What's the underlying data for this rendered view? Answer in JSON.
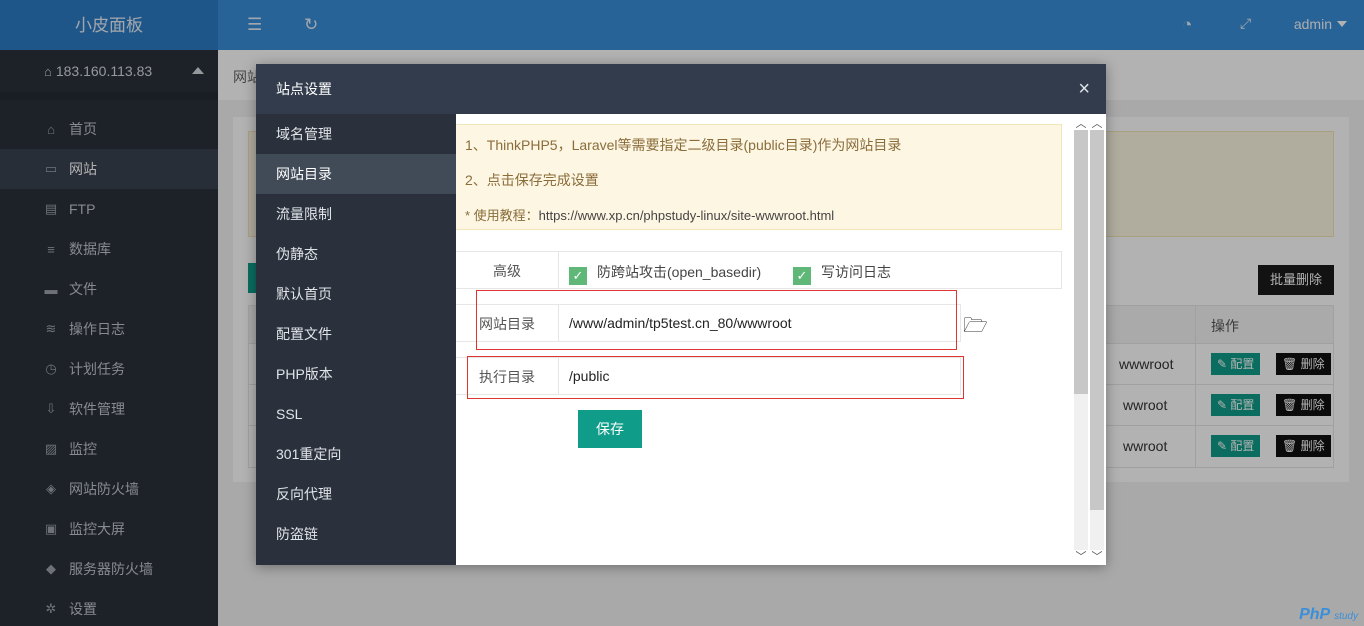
{
  "sidebar": {
    "brand": "小皮面板",
    "server": "183.160.113.83",
    "items": [
      {
        "label": "首页",
        "icon": "⌂"
      },
      {
        "label": "网站",
        "icon": "▭"
      },
      {
        "label": "FTP",
        "icon": "▤"
      },
      {
        "label": "数据库",
        "icon": "≡"
      },
      {
        "label": "文件",
        "icon": "▬"
      },
      {
        "label": "操作日志",
        "icon": "≋"
      },
      {
        "label": "计划任务",
        "icon": "◷"
      },
      {
        "label": "软件管理",
        "icon": "⇩"
      },
      {
        "label": "监控",
        "icon": "▨"
      },
      {
        "label": "网站防火墙",
        "icon": "◈"
      },
      {
        "label": "监控大屏",
        "icon": "▣"
      },
      {
        "label": "服务器防火墙",
        "icon": "◆"
      },
      {
        "label": "设置",
        "icon": "✲"
      }
    ]
  },
  "topbar": {
    "user": "admin"
  },
  "background": {
    "breadcrumb": "网站",
    "batch_delete": "批量删除",
    "ops_header": "操作",
    "rows": [
      {
        "path": "wwwroot",
        "config": "✎ 配置",
        "delete": "🗑 删除"
      },
      {
        "path": "wwroot",
        "config": "✎ 配置",
        "delete": "🗑 删除"
      },
      {
        "path": "wwroot",
        "config": "✎ 配置",
        "delete": "🗑 删除"
      }
    ]
  },
  "modal": {
    "title": "站点设置",
    "close": "×",
    "nav": [
      "域名管理",
      "网站目录",
      "流量限制",
      "伪静态",
      "默认首页",
      "配置文件",
      "PHP版本",
      "SSL",
      "301重定向",
      "反向代理",
      "防盗链"
    ],
    "tips": {
      "line1": "1、ThinkPHP5，Laravel等需要指定二级目录(public目录)作为网站目录",
      "line2": "2、点击保存完成设置",
      "line3_prefix": "* 使用教程：",
      "line3_link": "https://www.xp.cn/phpstudy-linux/site-wwwroot.html"
    },
    "advanced": {
      "label": "高级",
      "option1": "防跨站攻击(open_basedir)",
      "option2": "写访问日志"
    },
    "site_dir": {
      "label": "网站目录",
      "value": "/www/admin/tp5test.cn_80/wwwroot"
    },
    "run_dir": {
      "label": "执行目录",
      "value": "/public"
    },
    "save": "保存"
  },
  "watermark": {
    "main": "PhP",
    "sub": "study"
  }
}
